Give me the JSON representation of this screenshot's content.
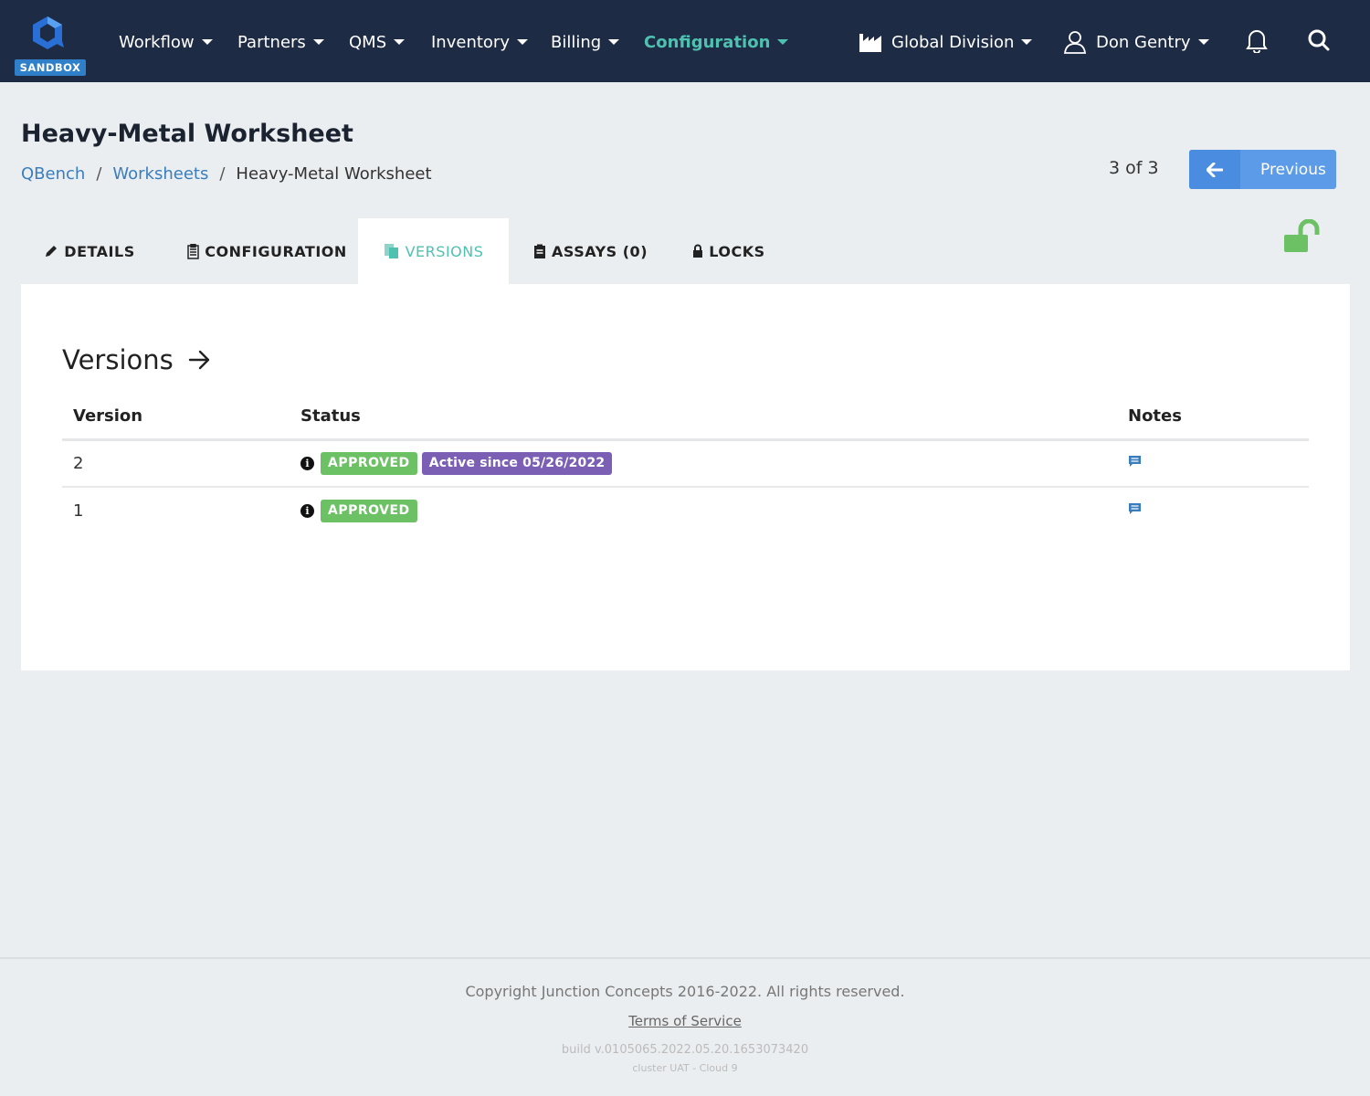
{
  "brand": {
    "sandbox_label": "SANDBOX"
  },
  "nav": {
    "items": [
      {
        "label": "Workflow"
      },
      {
        "label": "Partners"
      },
      {
        "label": "QMS"
      },
      {
        "label": "Inventory"
      },
      {
        "label": "Billing"
      },
      {
        "label": "Configuration",
        "active": true
      }
    ],
    "division": "Global Division",
    "user": "Don Gentry"
  },
  "header": {
    "title": "Heavy-Metal Worksheet",
    "breadcrumb": [
      "QBench",
      "Worksheets",
      "Heavy-Metal Worksheet"
    ],
    "pager_count": "3 of 3",
    "prev_label": "Previous"
  },
  "tabs": [
    {
      "label": "DETAILS",
      "icon": "pencil-icon"
    },
    {
      "label": "CONFIGURATION",
      "icon": "clipboard-list-icon"
    },
    {
      "label": "VERSIONS",
      "icon": "files-icon",
      "active": true
    },
    {
      "label": "ASSAYS (0)",
      "icon": "clipboard-icon"
    },
    {
      "label": "LOCKS",
      "icon": "lock-icon"
    }
  ],
  "versions": {
    "title": "Versions",
    "columns": [
      "Version",
      "Status",
      "Notes"
    ],
    "rows": [
      {
        "version": "2",
        "status": "APPROVED",
        "active_since": "Active since 05/26/2022"
      },
      {
        "version": "1",
        "status": "APPROVED"
      }
    ]
  },
  "footer": {
    "copyright": "Copyright Junction Concepts 2016-2022. All rights reserved.",
    "tos": "Terms of Service",
    "build": "build v.0105065.2022.05.20.1653073420",
    "cluster": "cluster UAT - Cloud 9"
  },
  "colors": {
    "nav_bg": "#1e2b45",
    "accent_teal": "#4fc1b0",
    "approved_green": "#6cc164",
    "active_purple": "#7b5fb5",
    "primary_blue": "#5b9be8",
    "unlock_green": "#6cc164"
  }
}
